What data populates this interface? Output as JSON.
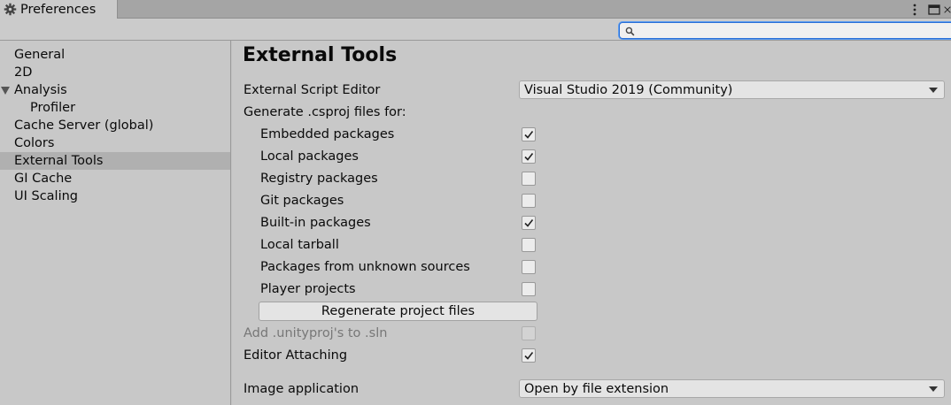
{
  "window": {
    "tab_title": "Preferences",
    "icons": {
      "tab": "gear-icon",
      "menu": "kebab-menu-icon",
      "maximize": "maximize-icon",
      "close": "close-icon"
    }
  },
  "search": {
    "value": "",
    "placeholder": "",
    "icon": "search-icon"
  },
  "sidebar": {
    "items": [
      {
        "label": "General"
      },
      {
        "label": "2D"
      },
      {
        "label": "Analysis"
      },
      {
        "label": "Profiler"
      },
      {
        "label": "Cache Server (global)"
      },
      {
        "label": "Colors"
      },
      {
        "label": "External Tools"
      },
      {
        "label": "GI Cache"
      },
      {
        "label": "UI Scaling"
      }
    ],
    "selected": "External Tools"
  },
  "main": {
    "title": "External Tools",
    "script_editor": {
      "label": "External Script Editor",
      "value": "Visual Studio 2019 (Community)"
    },
    "generate_label": "Generate .csproj files for:",
    "packages": [
      {
        "label": "Embedded packages",
        "checked": true
      },
      {
        "label": "Local packages",
        "checked": true
      },
      {
        "label": "Registry packages",
        "checked": false
      },
      {
        "label": "Git packages",
        "checked": false
      },
      {
        "label": "Built-in packages",
        "checked": true
      },
      {
        "label": "Local tarball",
        "checked": false
      },
      {
        "label": "Packages from unknown sources",
        "checked": false
      },
      {
        "label": "Player projects",
        "checked": false
      }
    ],
    "regenerate_label": "Regenerate project files",
    "unityproj": {
      "label": "Add .unityproj's to .sln",
      "checked": false,
      "disabled": true
    },
    "editor_attaching": {
      "label": "Editor Attaching",
      "checked": true
    },
    "image_application": {
      "label": "Image application",
      "value": "Open by file extension"
    }
  }
}
